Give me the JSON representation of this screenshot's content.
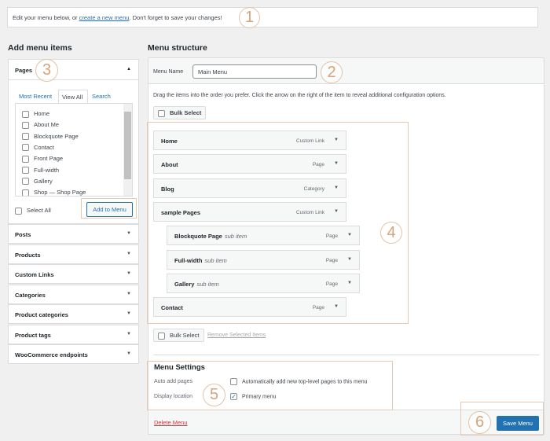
{
  "notice": {
    "prefix": "Edit your menu below, or ",
    "link": "create a new menu",
    "suffix": ". Don't forget to save your changes!"
  },
  "annotations": [
    "1",
    "2",
    "3",
    "4",
    "5",
    "6"
  ],
  "left": {
    "title": "Add menu items",
    "pages_header": "Pages",
    "tabs": [
      "Most Recent",
      "View All",
      "Search"
    ],
    "pages": [
      "Home",
      "About Me",
      "Blockquote Page",
      "Contact",
      "Front Page",
      "Full-width",
      "Gallery",
      "Shop — Shop Page"
    ],
    "select_all": "Select All",
    "add_button": "Add to Menu",
    "sections": [
      "Posts",
      "Products",
      "Custom Links",
      "Categories",
      "Product categories",
      "Product tags",
      "WooCommerce endpoints"
    ]
  },
  "right": {
    "title": "Menu structure",
    "menu_name_label": "Menu Name",
    "menu_name_value": "Main Menu",
    "instructions": "Drag the items into the order you prefer. Click the arrow on the right of the item to reveal additional configuration options.",
    "bulk_select": "Bulk Select",
    "remove_selected": "Remove Selected Items",
    "items": [
      {
        "title": "Home",
        "type": "Custom Link",
        "sub": ""
      },
      {
        "title": "About",
        "type": "Page",
        "sub": ""
      },
      {
        "title": "Blog",
        "type": "Category",
        "sub": ""
      },
      {
        "title": "sample Pages",
        "type": "Custom Link",
        "sub": ""
      },
      {
        "title": "Blockquote Page",
        "type": "Page",
        "sub": "sub item"
      },
      {
        "title": "Full-width",
        "type": "Page",
        "sub": "sub item"
      },
      {
        "title": "Gallery",
        "type": "Page",
        "sub": "sub item"
      },
      {
        "title": "Contact",
        "type": "Page",
        "sub": ""
      }
    ],
    "settings": {
      "title": "Menu Settings",
      "auto_add_label": "Auto add pages",
      "auto_add_text": "Automatically add new top-level pages to this menu",
      "display_label": "Display location",
      "display_text": "Primary menu",
      "primary_checked": true
    },
    "delete": "Delete Menu",
    "save": "Save Menu"
  },
  "colors": {
    "accent": "#2271b1",
    "danger": "#d63638",
    "annotation": "#d6a37c"
  }
}
